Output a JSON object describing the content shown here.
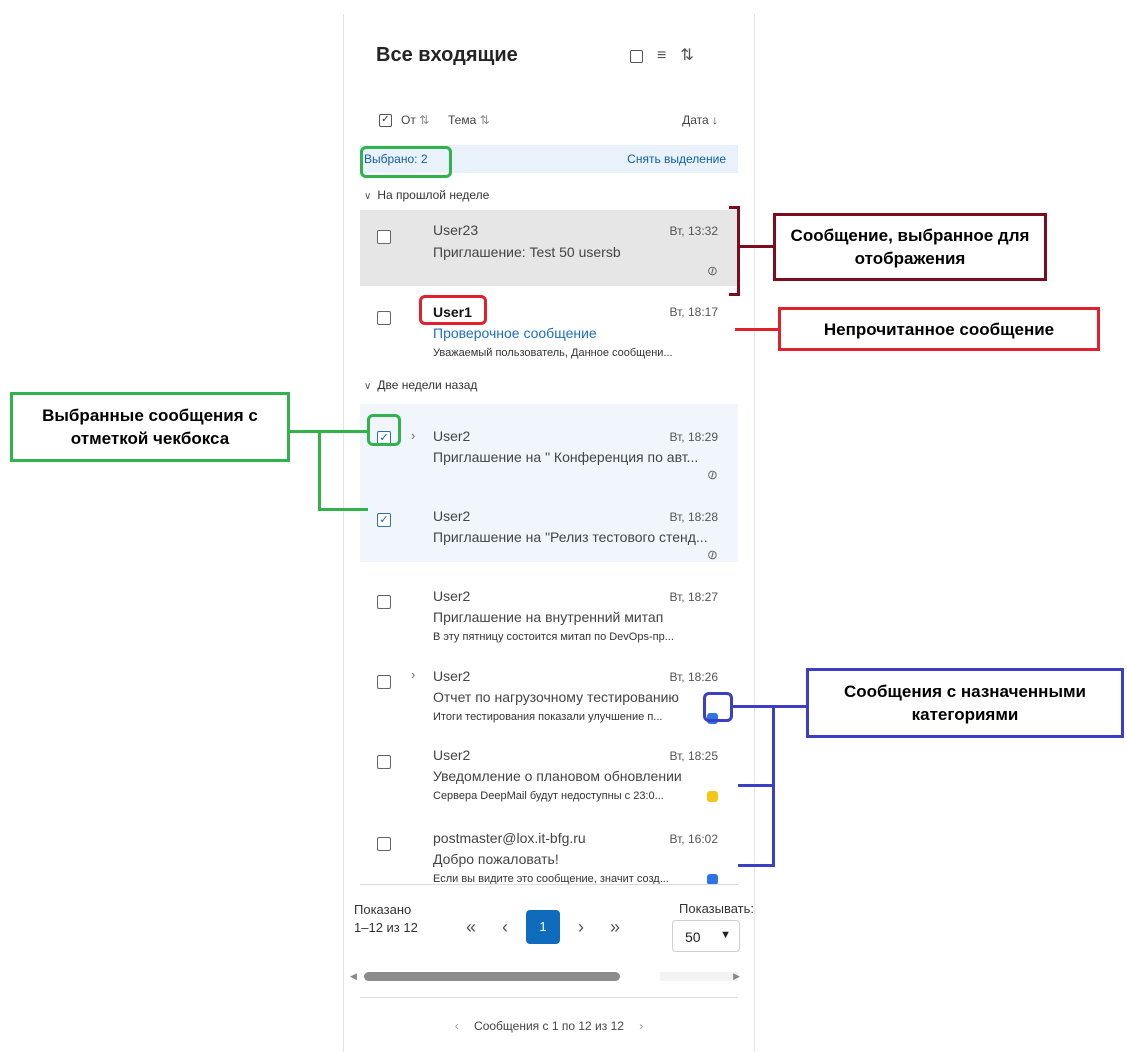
{
  "header": {
    "title": "Все входящие"
  },
  "toolbar": {
    "select_icon": "square-icon",
    "filter_icon": "filter-icon",
    "sort_icon": "sort-icon"
  },
  "columns": {
    "from": "От",
    "subject": "Тема",
    "date": "Дата"
  },
  "selection": {
    "count_label": "Выбрано: 2",
    "clear_label": "Снять выделение"
  },
  "groups": {
    "last_week": "На прошлой неделе",
    "two_weeks": "Две недели назад"
  },
  "messages": [
    {
      "sender": "User23",
      "time": "Вт, 13:32",
      "subject": "Приглашение: Test 50 usersb",
      "preview": "",
      "attachment": true,
      "state": "viewed"
    },
    {
      "sender": "User1",
      "time": "Вт, 18:17",
      "subject": "Проверочное сообщение",
      "preview": "Уважаемый пользователь, Данное сообщени...",
      "attachment": false,
      "state": "unread"
    },
    {
      "sender": "User2",
      "time": "Вт, 18:29",
      "subject": "Приглашение на \" Конференция по авт...",
      "preview": "",
      "attachment": true,
      "state": "checked",
      "has_thread": true
    },
    {
      "sender": "User2",
      "time": "Вт, 18:28",
      "subject": "Приглашение на \"Релиз тестового стенд...",
      "preview": "",
      "attachment": true,
      "state": "checked"
    },
    {
      "sender": "User2",
      "time": "Вт, 18:27",
      "subject": "Приглашение на внутренний митап",
      "preview": "В эту пятницу состоится митап по DevOps-пр...",
      "attachment": false,
      "state": "normal"
    },
    {
      "sender": "User2",
      "time": "Вт, 18:26",
      "subject": "Отчет по нагрузочному тестированию",
      "preview": "Итоги тестирования показали улучшение п...",
      "category_color": "#2f74e6",
      "state": "normal",
      "has_thread": true
    },
    {
      "sender": "User2",
      "time": "Вт, 18:25",
      "subject": "Уведомление о плановом обновлении",
      "preview": "Сервера DeepMail будут недоступны с 23:0...",
      "category_color": "#f5c518",
      "state": "normal"
    },
    {
      "sender": "postmaster@lox.it-bfg.ru",
      "time": "Вт, 16:02",
      "subject": "Добро пожаловать!",
      "preview": "Если вы видите это сообщение, значит созд...",
      "category_color": "#2f74e6",
      "state": "normal"
    }
  ],
  "pager": {
    "shown_label": "Показано",
    "range_label": "1–12 из 12",
    "current_page": "1",
    "show_label": "Показывать:",
    "page_size": "50",
    "first": "«",
    "prev": "‹",
    "next": "›",
    "last": "»"
  },
  "footer": {
    "text": "Сообщения с 1 по 12 из 12",
    "prev": "‹",
    "next": "›"
  },
  "annotations": {
    "viewed": "Сообщение, выбранное для отображения",
    "unread": "Непрочитанное сообщение",
    "checked": "Выбранные сообщения с отметкой чекбокса",
    "categories": "Сообщения с назначенными категориями"
  },
  "colors": {
    "accent": "#0f6cbd",
    "annot_dark_red": "#7b0d1e",
    "annot_red": "#e0202a",
    "annot_green": "#2fb34a",
    "annot_blue": "#3b3fc4"
  }
}
